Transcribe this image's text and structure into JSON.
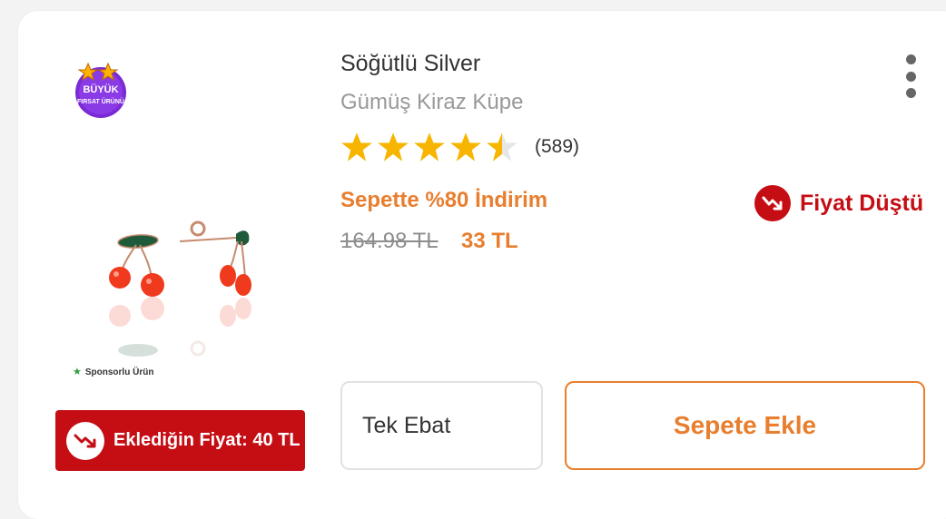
{
  "product": {
    "brand": "Söğütlü Silver",
    "name": "Gümüş Kiraz Küpe",
    "rating_value": 4.5,
    "rating_max": 5,
    "review_count": "(589)",
    "badge_lines": [
      "BÜYÜK",
      "FIRSAT ÜRÜNÜ"
    ],
    "sponsored_label": "Sponsorlu Ürün"
  },
  "pricing": {
    "promo": "Sepette %80 İndirim",
    "old_price": "164.98 TL",
    "new_price": "33 TL",
    "price_drop_label": "Fiyat Düştü",
    "added_price_label": "Eklediğin Fiyat: 40 TL"
  },
  "actions": {
    "size_value": "Tek Ebat",
    "add_to_cart_label": "Sepete Ekle"
  },
  "colors": {
    "accent": "#e87e2e",
    "alert_red": "#c50d14",
    "star": "#f7b500"
  },
  "icons": {
    "menu": "more-vertical-icon",
    "price_drop": "trend-down-icon",
    "sponsor": "star-icon"
  }
}
